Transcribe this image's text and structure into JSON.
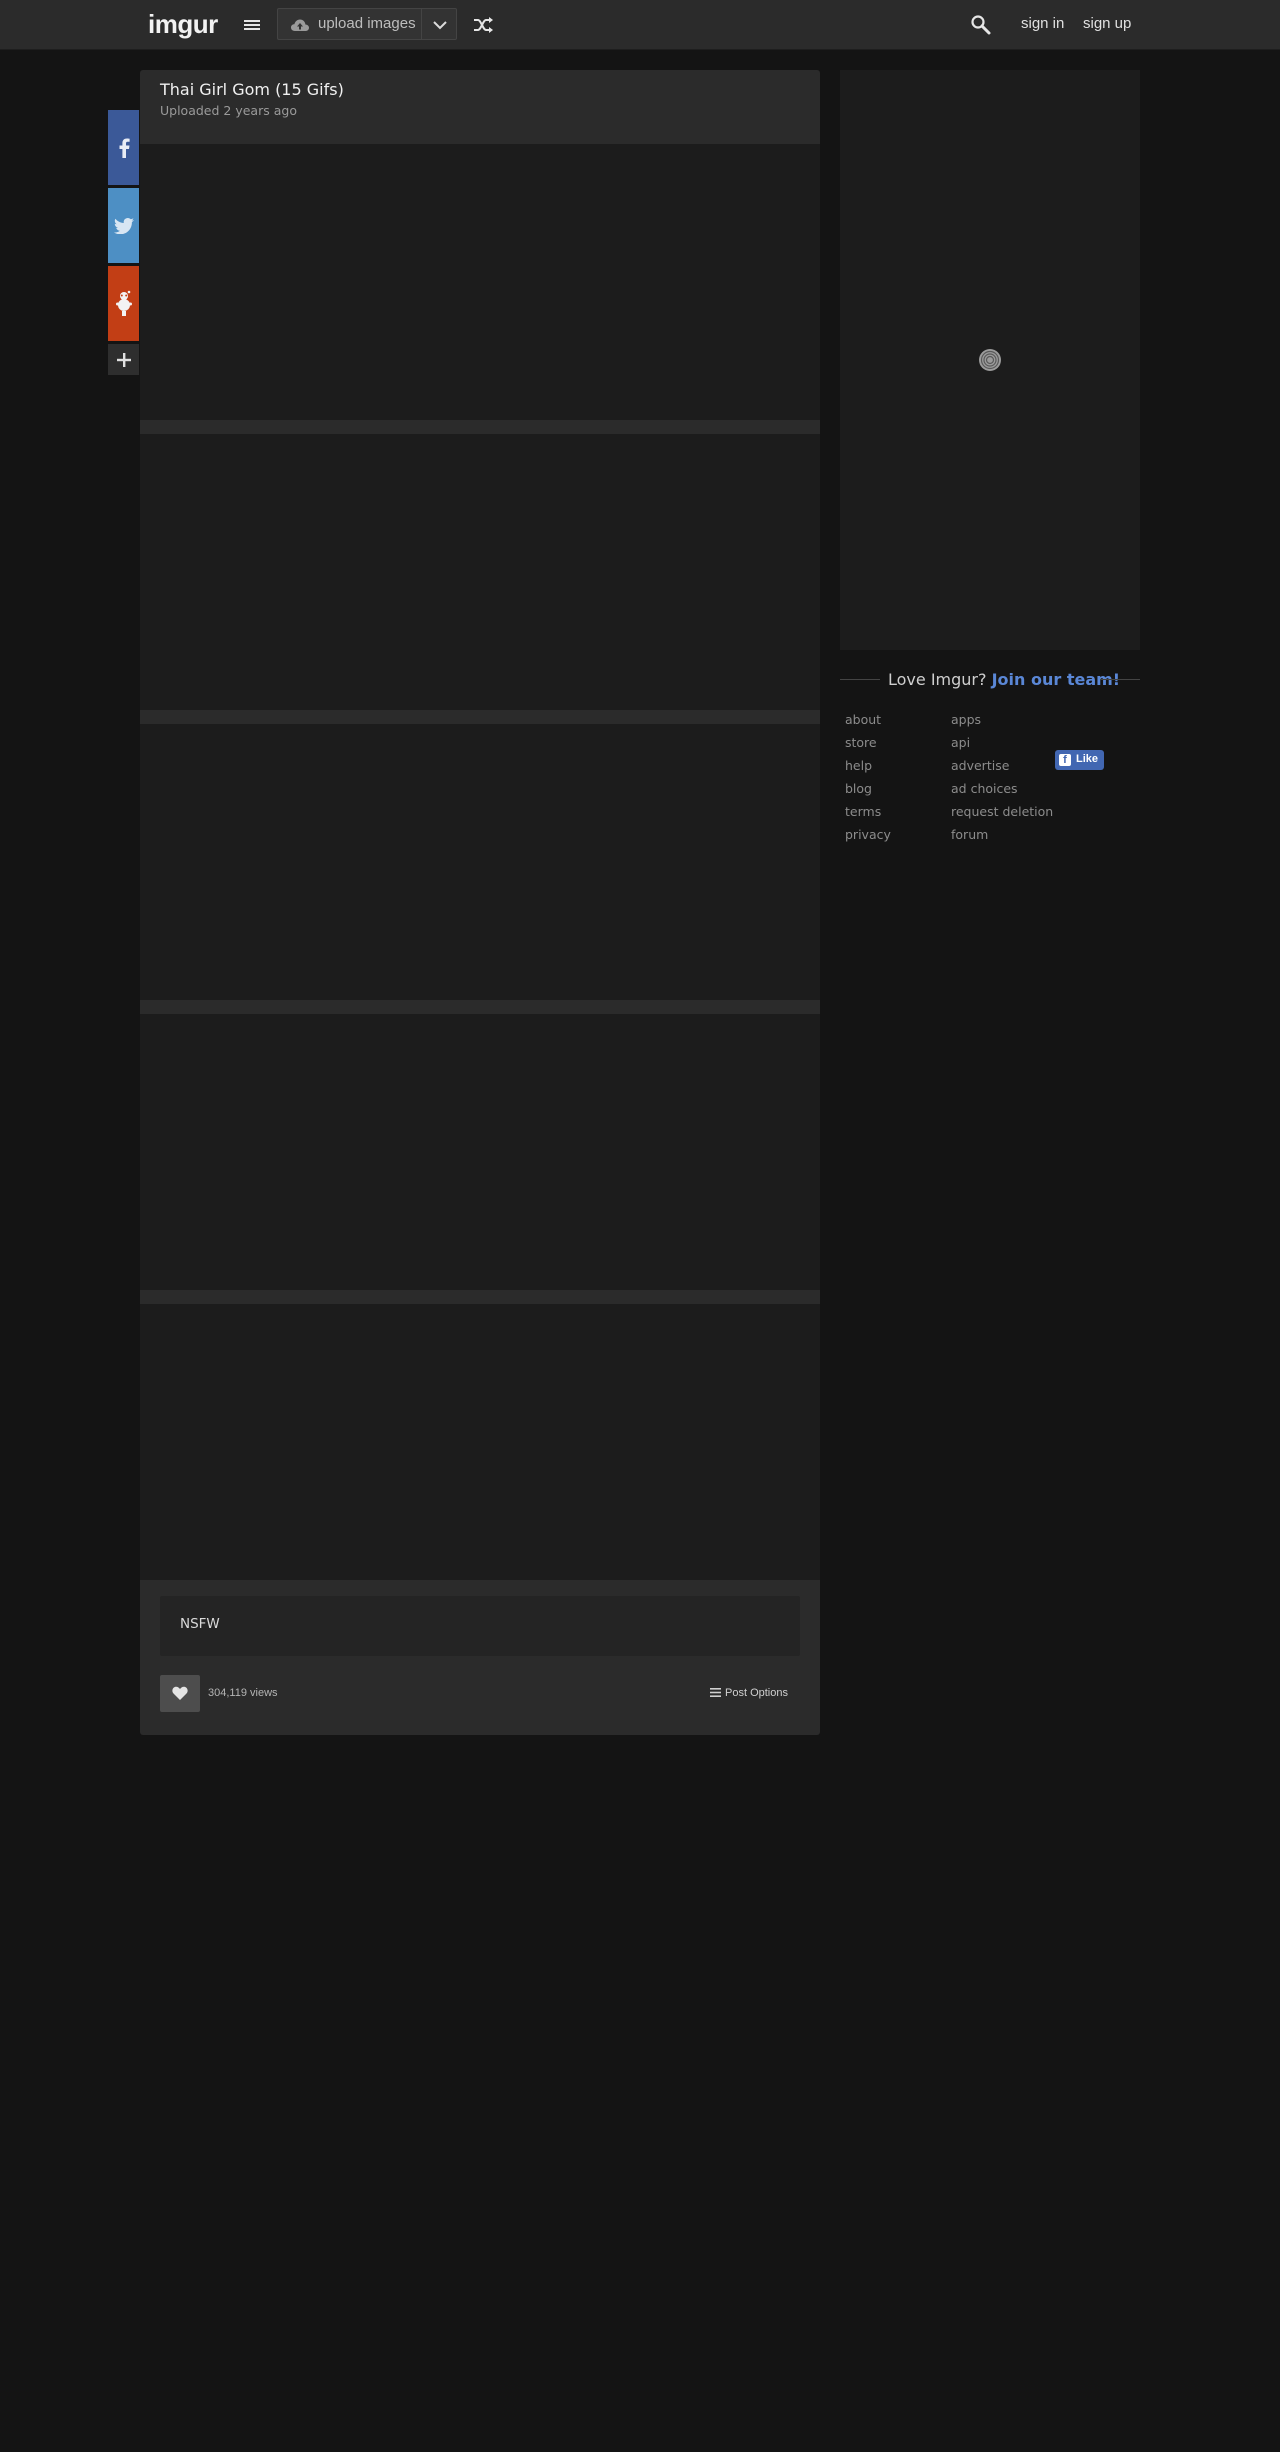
{
  "header": {
    "logo": "imgur",
    "upload_label": "upload images",
    "sign_in": "sign in",
    "sign_up": "sign up"
  },
  "post": {
    "title": "Thai Girl Gom (15 Gifs)",
    "uploaded_label": "Uploaded",
    "uploaded_time": "2 years ago",
    "description": "NSFW",
    "views": "304,119 views",
    "post_options": "Post Options"
  },
  "sidebar": {
    "love_text": "Love Imgur?",
    "join_text": "Join our team!",
    "links_col1": [
      "about",
      "store",
      "help",
      "blog",
      "terms",
      "privacy"
    ],
    "links_col2": [
      "apps",
      "api",
      "advertise",
      "ad choices",
      "request deletion",
      "forum"
    ],
    "fb_like": "Like"
  },
  "share": {
    "icons": [
      "facebook-icon",
      "twitter-icon",
      "reddit-icon",
      "plus-icon"
    ]
  },
  "colors": {
    "page_bg": "#141414",
    "bar_bg": "#2b2b2b",
    "media_bg": "#1c1c1c",
    "facebook": "#3b5998",
    "twitter": "#4d8fc4",
    "reddit": "#c23e15",
    "accent_link": "#5a87d6"
  }
}
